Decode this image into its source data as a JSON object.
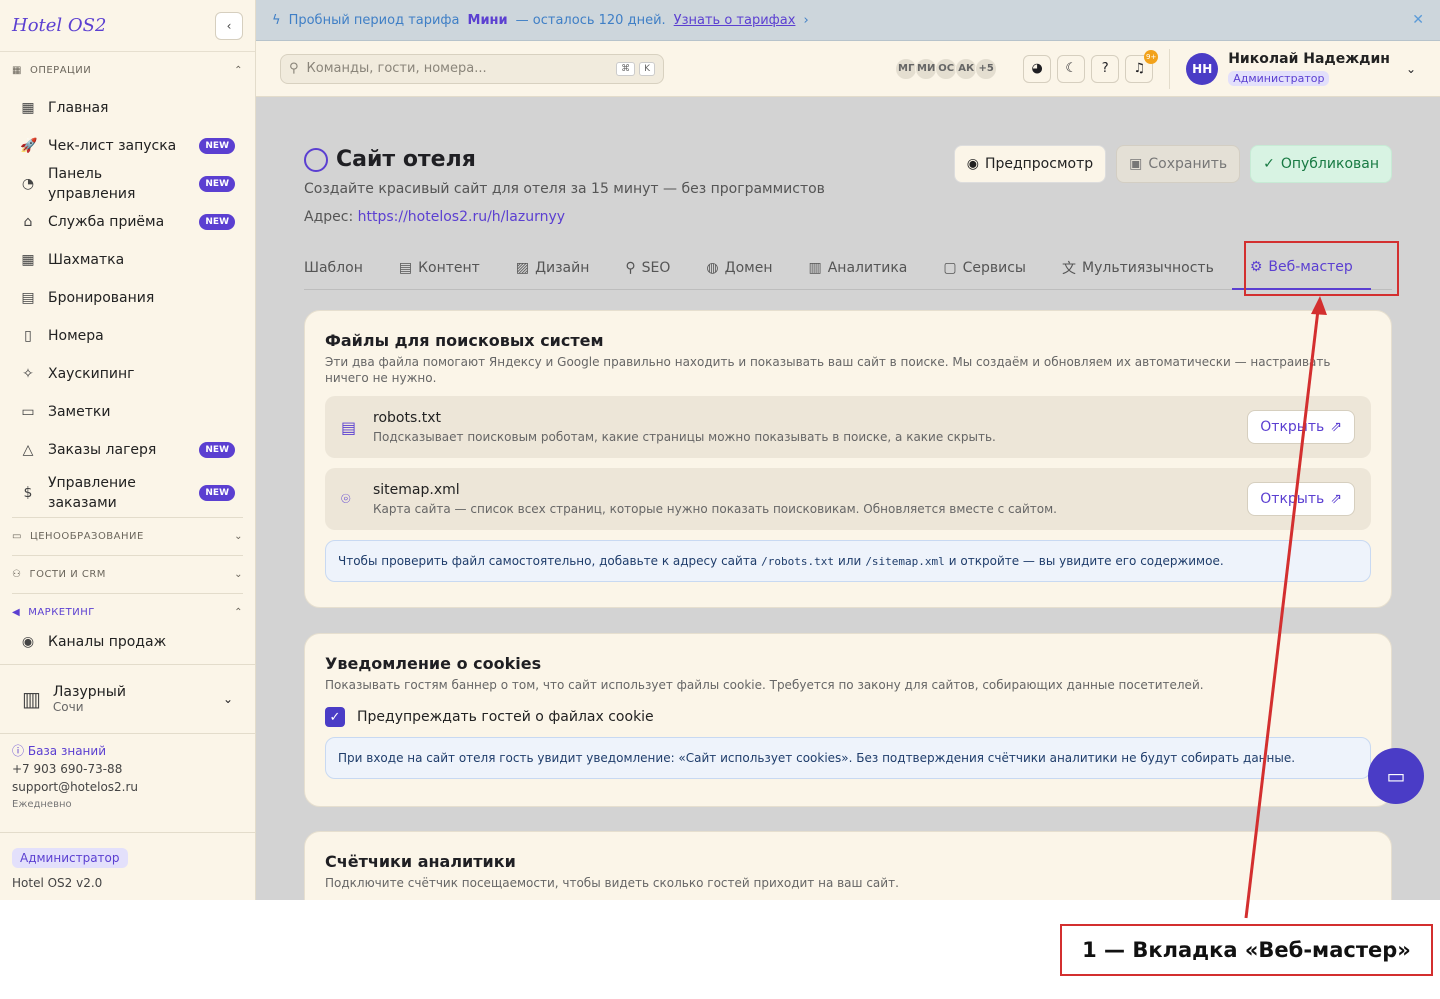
{
  "sidebar": {
    "logo": "Hotel OS2",
    "collapse_icon": "‹",
    "sections": {
      "operations": "ОПЕРАЦИИ",
      "pricing": "ЦЕНООБРАЗОВАНИЕ",
      "guests": "ГОСТИ И CRM",
      "marketing": "МАРКЕТИНГ"
    },
    "items": [
      {
        "label": "Главная",
        "icon": "grid-icon",
        "glyph": "▦",
        "new": false
      },
      {
        "label": "Чек-лист запуска",
        "icon": "rocket-icon",
        "glyph": "🚀",
        "new": true
      },
      {
        "label": "Панель управления",
        "icon": "gauge-icon",
        "glyph": "◔",
        "new": true
      },
      {
        "label": "Служба приёма",
        "icon": "bell-desk-icon",
        "glyph": "⌂",
        "new": true
      },
      {
        "label": "Шахматка",
        "icon": "table-icon",
        "glyph": "▦",
        "new": false
      },
      {
        "label": "Бронирования",
        "icon": "clipboard-icon",
        "glyph": "▤",
        "new": false
      },
      {
        "label": "Номера",
        "icon": "door-icon",
        "glyph": "▯",
        "new": false
      },
      {
        "label": "Хаускипинг",
        "icon": "sparkles-icon",
        "glyph": "✧",
        "new": false
      },
      {
        "label": "Заметки",
        "icon": "note-icon",
        "glyph": "▭",
        "new": false
      },
      {
        "label": "Заказы лагеря",
        "icon": "tent-icon",
        "glyph": "△",
        "new": true
      },
      {
        "label": "Управление заказами",
        "icon": "dollar-icon",
        "glyph": "$",
        "new": true
      }
    ],
    "marketing_items": [
      {
        "label": "Каналы продаж",
        "icon": "broadcast-icon",
        "glyph": "◉"
      }
    ],
    "new_badge": "NEW",
    "hotel": {
      "name": "Лазурный",
      "city": "Сочи"
    },
    "support": {
      "kb_label": "База знаний",
      "phone": "+7 903 690-73-88",
      "email": "support@hotelos2.ru",
      "hours": "Ежедневно"
    },
    "role": "Администратор",
    "version": "Hotel OS2 v2.0"
  },
  "banner": {
    "text_before": "Пробный период тарифа",
    "plan": "Мини",
    "text_after": "— осталось 120 дней.",
    "link": "Узнать о тарифах"
  },
  "topbar": {
    "search_placeholder": "Команды, гости, номера...",
    "kbd": [
      "⌘",
      "K"
    ],
    "avatars": [
      "МГ",
      "МИ",
      "ОС",
      "АК",
      "+5"
    ],
    "notif_count": "9+",
    "user": {
      "initials": "НН",
      "name": "Николай Надеждин",
      "role": "Администратор"
    }
  },
  "page": {
    "title": "Сайт отеля",
    "subtitle": "Создайте красивый сайт для отеля за 15 минут — без программистов",
    "address_label": "Адрес:",
    "address_url": "https://hotelos2.ru/h/lazurnyy",
    "actions": {
      "preview": "Предпросмотр",
      "save": "Сохранить",
      "published": "Опубликован"
    },
    "tabs": [
      {
        "label": "Шаблон",
        "icon": ""
      },
      {
        "label": "Контент",
        "icon": "▤"
      },
      {
        "label": "Дизайн",
        "icon": "▨"
      },
      {
        "label": "SEO",
        "icon": "⚲"
      },
      {
        "label": "Домен",
        "icon": "◍"
      },
      {
        "label": "Аналитика",
        "icon": "▥"
      },
      {
        "label": "Сервисы",
        "icon": "▢"
      },
      {
        "label": "Мультиязычность",
        "icon": "文"
      },
      {
        "label": "Веб-мастер",
        "icon": "⚙"
      }
    ],
    "search_files": {
      "title": "Файлы для поисковых систем",
      "desc": "Эти два файла помогают Яндексу и Google правильно находить и показывать ваш сайт в поиске. Мы создаём и обновляем их автоматически — настраивать ничего не нужно.",
      "files": [
        {
          "name": "robots.txt",
          "desc": "Подсказывает поисковым роботам, какие страницы можно показывать в поиске, а какие скрыть.",
          "open": "Открыть"
        },
        {
          "name": "sitemap.xml",
          "desc": "Карта сайта — список всех страниц, которые нужно показать поисковикам. Обновляется вместе с сайтом.",
          "open": "Открыть"
        }
      ],
      "info_a": "Чтобы проверить файл самостоятельно, добавьте к адресу сайта",
      "info_code1": "/robots.txt",
      "info_b": "или",
      "info_code2": "/sitemap.xml",
      "info_c": "и откройте — вы увидите его содержимое."
    },
    "cookies": {
      "title": "Уведомление о cookies",
      "desc": "Показывать гостям баннер о том, что сайт использует файлы cookie. Требуется по закону для сайтов, собирающих данные посетителей.",
      "checkbox_label": "Предупреждать гостей о файлах cookie",
      "checked": true,
      "info": "При входе на сайт отеля гость увидит уведомление: «Сайт использует cookies». Без подтверждения счётчики аналитики не будут собирать данные."
    },
    "analytics": {
      "title": "Счётчики аналитики",
      "desc": "Подключите счётчик посещаемости, чтобы видеть сколько гостей приходит на ваш сайт."
    }
  },
  "annotation": {
    "label": "1 — Вкладка «Веб-мастер»",
    "color": "#d32f2f"
  }
}
